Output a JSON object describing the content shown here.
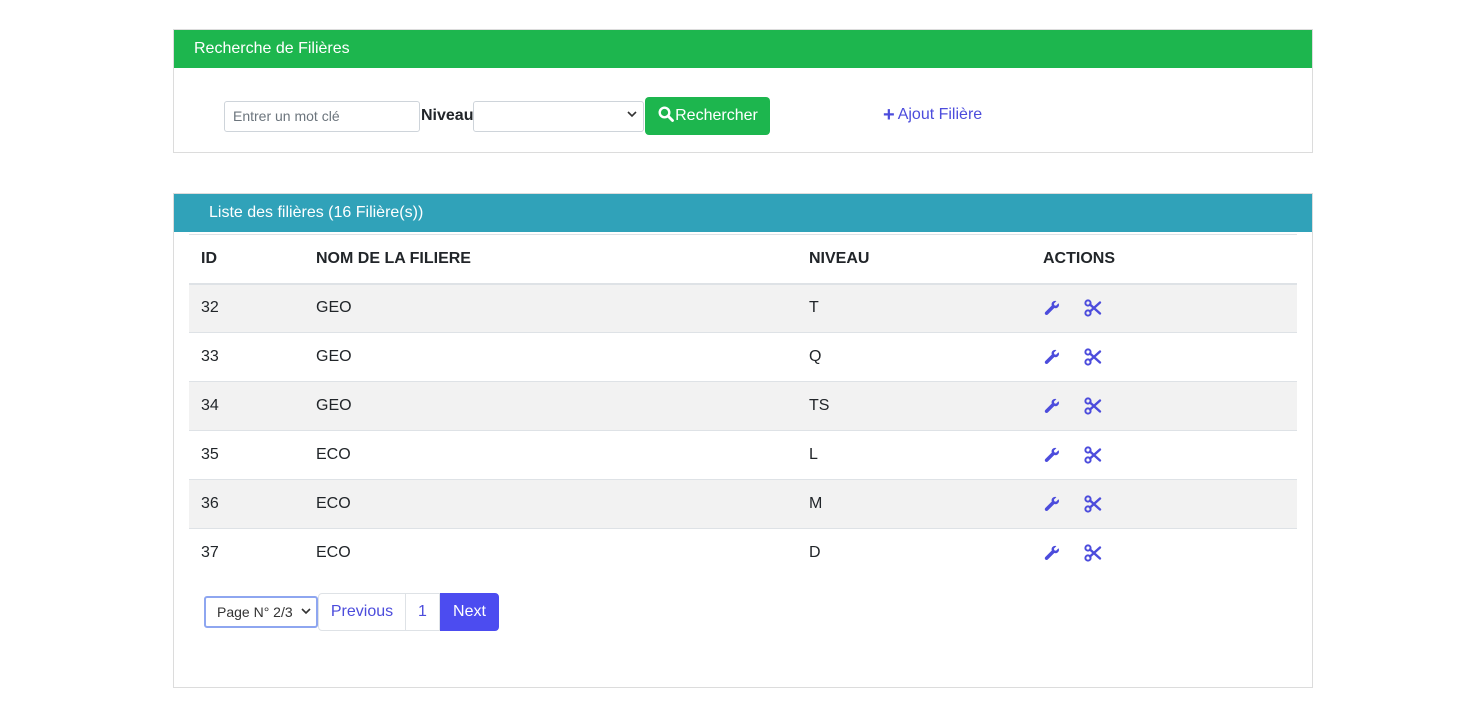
{
  "search_panel": {
    "title": "Recherche de Filières",
    "keyword_placeholder": "Entrer un mot clé",
    "niveau_label": "Niveau",
    "niveau_selected": "",
    "search_button": "Rechercher",
    "add_link": "Ajout Filière"
  },
  "list_panel": {
    "title": "Liste des filières (16 Filière(s))",
    "columns": [
      "ID",
      "NOM DE LA FILIERE",
      "NIVEAU",
      "ACTIONS"
    ],
    "rows": [
      {
        "id": "32",
        "nom": "GEO",
        "niveau": "T"
      },
      {
        "id": "33",
        "nom": "GEO",
        "niveau": "Q"
      },
      {
        "id": "34",
        "nom": "GEO",
        "niveau": "TS"
      },
      {
        "id": "35",
        "nom": "ECO",
        "niveau": "L"
      },
      {
        "id": "36",
        "nom": "ECO",
        "niveau": "M"
      },
      {
        "id": "37",
        "nom": "ECO",
        "niveau": "D"
      }
    ],
    "actions": [
      "wrench-icon",
      "scissors-icon"
    ]
  },
  "pagination": {
    "page_select": "Page N° 2/3",
    "previous": "Previous",
    "page_1": "1",
    "next": "Next"
  },
  "colors": {
    "search_header": "#1db64e",
    "list_header": "#30a2b9",
    "link": "#4c4cdc",
    "next_button": "#4c4cf0"
  }
}
